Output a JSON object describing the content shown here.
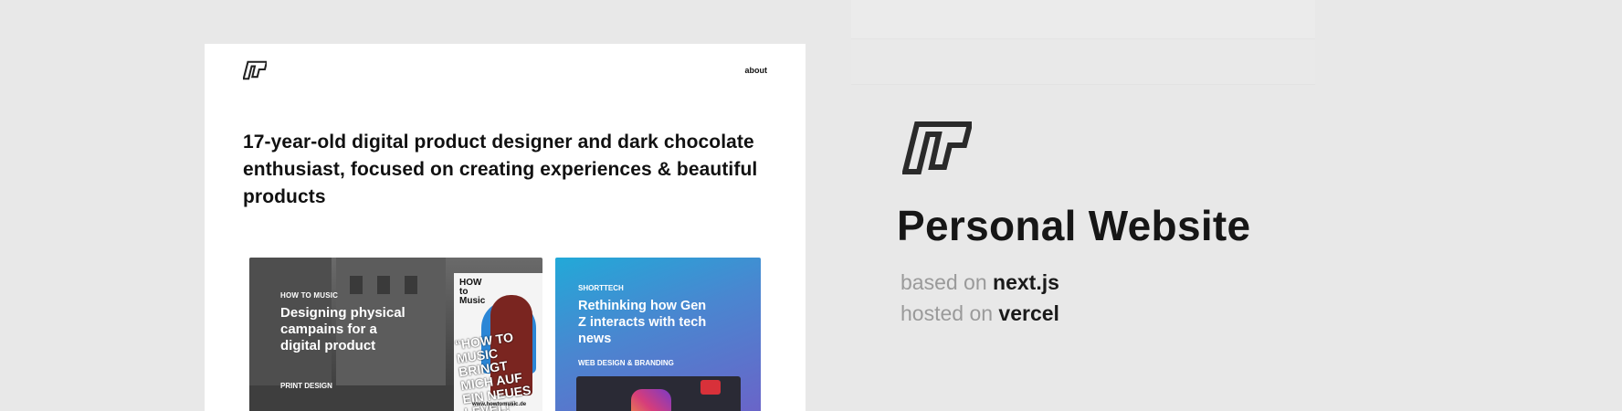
{
  "preview": {
    "nav_about": "about",
    "headline": "17-year-old digital product designer and dark chocolate enthusiast, focused on creating experiences & beautiful products",
    "projects": [
      {
        "kicker": "HOW TO MUSIC",
        "title": "Designing physical campains for a digital product",
        "tag": "PRINT DESIGN"
      },
      {
        "kicker": "SHORTTECH",
        "title": "Rethinking how Gen Z interacts with tech news",
        "tag": "WEB DESIGN & BRANDING"
      }
    ],
    "poster": {
      "title_word_1": "HOW",
      "title_word_2": "to",
      "title_word_3": "Music",
      "slogan": "“HOW TO MUSIC BRINGT MICH AUF EIN NEUES LEVEL!”",
      "url": "www.howtomusic.de"
    }
  },
  "info": {
    "title": "Personal Website",
    "based_on_prefix": "based on",
    "based_on_value": "next.js",
    "hosted_on_prefix": "hosted on",
    "hosted_on_value": "vercel"
  },
  "colors": {
    "page_bg": "#e8e8e8",
    "card_two_gradient_start": "#22a9d8",
    "card_two_gradient_end": "#6a64c8"
  },
  "icons": [
    "logo-mark-icon",
    "instagram-icon"
  ]
}
